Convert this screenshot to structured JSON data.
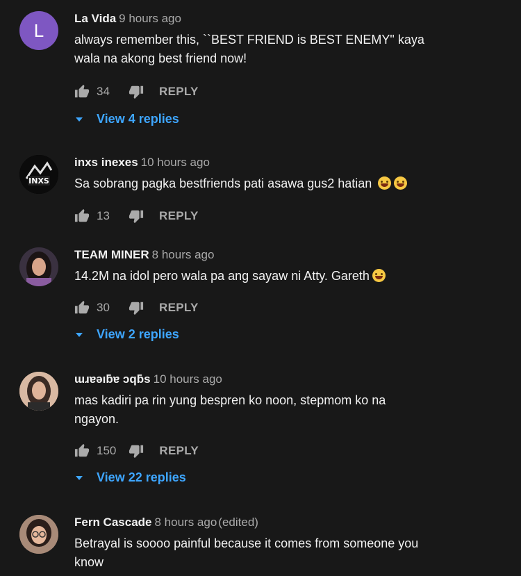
{
  "comments": [
    {
      "author": "La Vida",
      "time": "9 hours ago",
      "avatar_letter": "L",
      "text_lines": [
        "always remember this, ``BEST FRIEND is BEST ENEMY\" kaya",
        "wala na akong best friend now!"
      ],
      "likes": "34",
      "reply_label": "REPLY",
      "replies_label": "View 4 replies"
    },
    {
      "author": "inxs inexes",
      "time": "10 hours ago",
      "avatar_text": "INXS",
      "text": "Sa sobrang pagka bestfriends pati asawa gus2 hatian",
      "likes": "13",
      "reply_label": "REPLY"
    },
    {
      "author": "TEAM MINER",
      "time": "8 hours ago",
      "text": "14.2M na idol pero wala pa ang sayaw ni Atty. Gareth",
      "likes": "30",
      "reply_label": "REPLY",
      "replies_label": "View 2 replies"
    },
    {
      "author": "ɯɹɐǝıƃɐ ɔqƃs",
      "time": "10 hours ago",
      "text_lines": [
        "mas kadiri pa rin yung bespren ko noon, stepmom ko na",
        "ngayon."
      ],
      "likes": "150",
      "reply_label": "REPLY",
      "replies_label": "View 22 replies"
    },
    {
      "author": "Fern Cascade",
      "time": "8 hours ago",
      "edited": "(edited)",
      "text_lines": [
        "Betrayal is soooo painful because it comes from someone you",
        "know"
      ]
    }
  ],
  "colors": {
    "background": "#181818",
    "link": "#3ea6ff",
    "muted": "#aaaaaa",
    "avatar_letter_bg": "#7e57c2"
  }
}
